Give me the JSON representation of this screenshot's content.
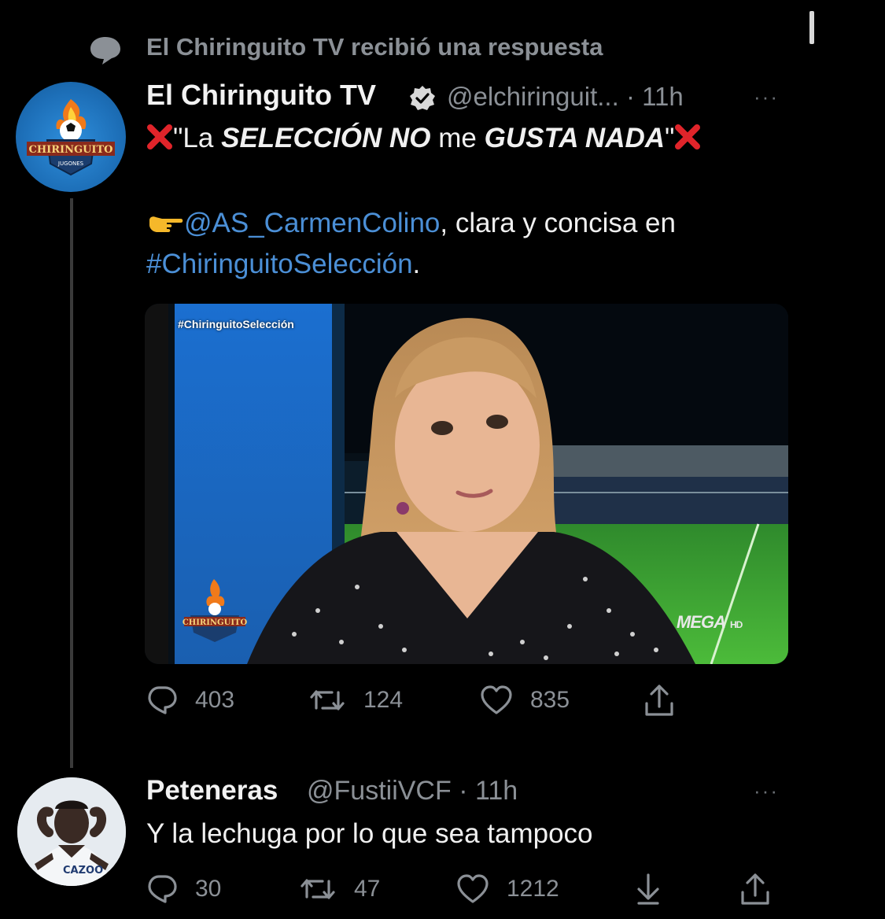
{
  "context": {
    "text": "El Chiringuito TV recibió una respuesta"
  },
  "tweet": {
    "author_name": "El Chiringuito TV",
    "handle": "@elchiringuit...",
    "time": "· 11h",
    "more": "···",
    "quote_open": "\"La ",
    "quote_bold1": "SELECCIÓN NO",
    "quote_mid": " me ",
    "quote_bold2": "GUSTA NADA",
    "quote_close": "\"",
    "mention": "@AS_CarmenColino",
    "body_after_mention": ", clara y concisa en",
    "hashtag": "#ChiringuitoSelección",
    "period": ".",
    "media": {
      "overlay_hashtag": "#ChiringuitoSelección",
      "channel_logo": "MEGA",
      "channel_hd": "HD",
      "logo_text": "CHIRINGUITO"
    },
    "actions": {
      "replies": "403",
      "retweets": "124",
      "likes": "835"
    }
  },
  "reply": {
    "author_name": "Peteneras",
    "handle": "@FustiiVCF · 11h",
    "more": "···",
    "text": "Y la lechuga por lo que sea tampoco",
    "avatar_text": "CAZOO",
    "actions": {
      "replies": "30",
      "retweets": "47",
      "likes": "1212"
    }
  },
  "avatar1": {
    "logo_text": "CHIRINGUITO",
    "sub_text": "JUGONES"
  },
  "colors": {
    "background": "#000000",
    "link": "#4b8fd6",
    "muted": "#8b9096",
    "x_mark": "#e0242a"
  }
}
